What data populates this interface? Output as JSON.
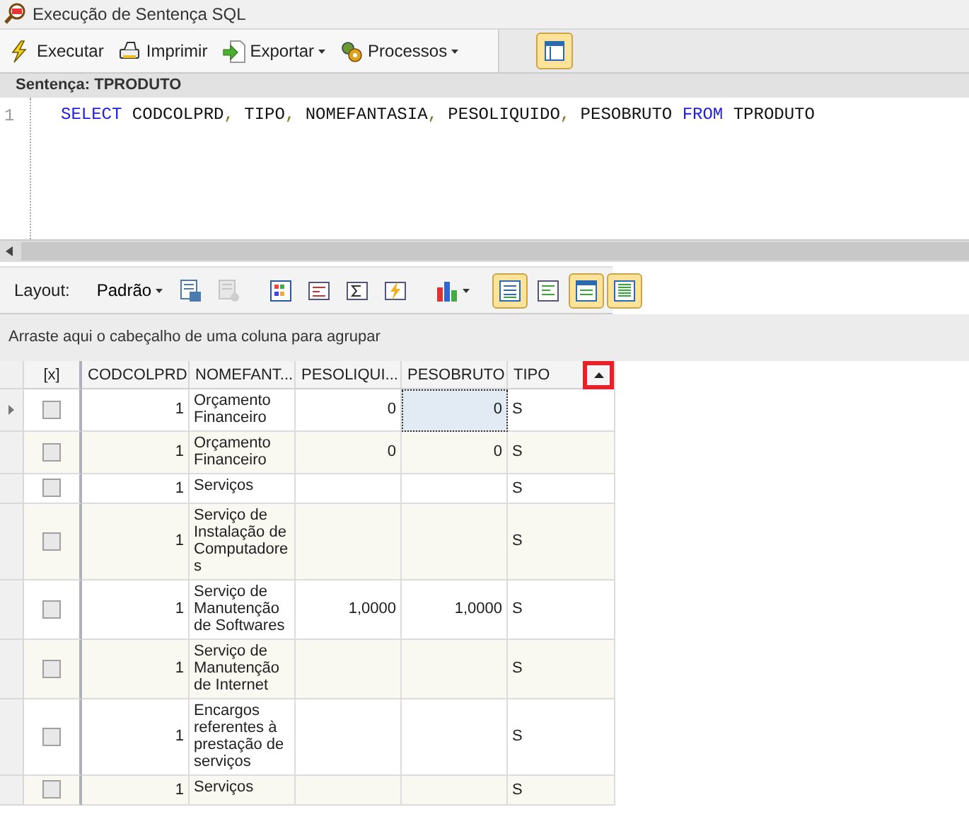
{
  "window": {
    "title": "Execução de Sentença SQL"
  },
  "toolbar": {
    "buttons": [
      {
        "label": "Executar",
        "dropdown": false
      },
      {
        "label": "Imprimir",
        "dropdown": false
      },
      {
        "label": "Exportar",
        "dropdown": true
      },
      {
        "label": "Processos",
        "dropdown": true
      }
    ],
    "toggle": {
      "pressed": true
    }
  },
  "editor": {
    "title": "Sentença: TPRODUTO",
    "line_number": "1",
    "tokens": [
      {
        "text": "SELECT",
        "kind": "keyword"
      },
      {
        "text": " CODCOLPRD",
        "kind": "ident"
      },
      {
        "text": ",",
        "kind": "punct"
      },
      {
        "text": " TIPO",
        "kind": "ident"
      },
      {
        "text": ",",
        "kind": "punct"
      },
      {
        "text": " NOMEFANTASIA",
        "kind": "ident"
      },
      {
        "text": ",",
        "kind": "punct"
      },
      {
        "text": " PESOLIQUIDO",
        "kind": "ident"
      },
      {
        "text": ",",
        "kind": "punct"
      },
      {
        "text": " PESOBRUTO ",
        "kind": "ident"
      },
      {
        "text": "FROM",
        "kind": "keyword"
      },
      {
        "text": " TPRODUTO",
        "kind": "ident"
      }
    ]
  },
  "grid_toolbar": {
    "label": "Layout:",
    "layout": {
      "label": "Padrão",
      "dropdown": true
    },
    "tools": [
      {
        "pressed": false
      },
      {
        "pressed": false,
        "disabled": true
      },
      {
        "pressed": false
      },
      {
        "pressed": false
      },
      {
        "pressed": false
      },
      {
        "pressed": false
      },
      {
        "pressed": false,
        "dropdown": true
      },
      {
        "pressed": true
      },
      {
        "pressed": false
      },
      {
        "pressed": true
      },
      {
        "pressed": true
      }
    ]
  },
  "group_panel": {
    "text": "Arraste aqui o cabeçalho de uma coluna para agrupar"
  },
  "grid": {
    "check_column": {
      "label": "[x]"
    },
    "columns": [
      {
        "label": "CODCOLPRD",
        "sorted_ascending": false,
        "highlighted": false
      },
      {
        "label": "NOMEFANT...",
        "sorted_ascending": false,
        "highlighted": false
      },
      {
        "label": "PESOLIQUI...",
        "sorted_ascending": false,
        "highlighted": false
      },
      {
        "label": "PESOBRUTO",
        "sorted_ascending": false,
        "highlighted": false
      },
      {
        "label": "TIPO",
        "sorted_ascending": true,
        "highlighted": true
      }
    ],
    "rows": [
      {
        "selected": true,
        "checked": false,
        "cells": [
          {
            "text": "1",
            "focused": false
          },
          {
            "text": "Orçamento Financeiro",
            "focused": false
          },
          {
            "text": "0",
            "focused": false
          },
          {
            "text": "0",
            "focused": true
          },
          {
            "text": "S",
            "focused": false
          }
        ]
      },
      {
        "selected": false,
        "checked": false,
        "cells": [
          {
            "text": "1",
            "focused": false
          },
          {
            "text": "Orçamento Financeiro",
            "focused": false
          },
          {
            "text": "0",
            "focused": false
          },
          {
            "text": "0",
            "focused": false
          },
          {
            "text": "S",
            "focused": false
          }
        ]
      },
      {
        "selected": false,
        "checked": false,
        "cells": [
          {
            "text": "1",
            "focused": false
          },
          {
            "text": "Serviços",
            "focused": false
          },
          {
            "focused": false
          },
          {
            "focused": false
          },
          {
            "text": "S",
            "focused": false
          }
        ]
      },
      {
        "selected": false,
        "checked": false,
        "cells": [
          {
            "text": "1",
            "focused": false
          },
          {
            "text": "Serviço de Instalação de Computadores",
            "focused": false
          },
          {
            "focused": false
          },
          {
            "focused": false
          },
          {
            "text": "S",
            "focused": false
          }
        ]
      },
      {
        "selected": false,
        "checked": false,
        "cells": [
          {
            "text": "1",
            "focused": false
          },
          {
            "text": "Serviço de Manutenção de Softwares",
            "focused": false
          },
          {
            "text": "1,0000",
            "focused": false
          },
          {
            "text": "1,0000",
            "focused": false
          },
          {
            "text": "S",
            "focused": false
          }
        ]
      },
      {
        "selected": false,
        "checked": false,
        "cells": [
          {
            "text": "1",
            "focused": false
          },
          {
            "text": "Serviço de Manutenção de Internet",
            "focused": false
          },
          {
            "focused": false
          },
          {
            "focused": false
          },
          {
            "text": "S",
            "focused": false
          }
        ]
      },
      {
        "selected": false,
        "checked": false,
        "cells": [
          {
            "text": "1",
            "focused": false
          },
          {
            "text": "Encargos referentes à prestação de serviços",
            "focused": false
          },
          {
            "focused": false
          },
          {
            "focused": false
          },
          {
            "text": "S",
            "focused": false
          }
        ]
      },
      {
        "selected": false,
        "checked": false,
        "cells": [
          {
            "text": "1",
            "focused": false
          },
          {
            "text": "Serviços",
            "focused": false
          },
          {
            "focused": false
          },
          {
            "focused": false
          },
          {
            "text": "S",
            "focused": false
          }
        ]
      }
    ]
  }
}
